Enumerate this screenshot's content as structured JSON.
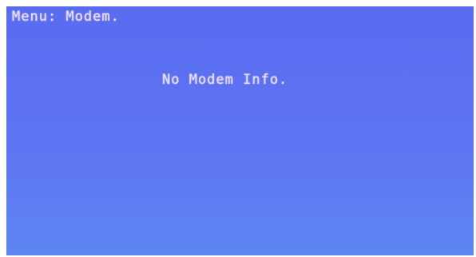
{
  "screen": {
    "menu_title": "Menu: Modem.",
    "message": "No Modem Info."
  },
  "colors": {
    "background": "#5d70f1",
    "text": "#e8dcff"
  }
}
